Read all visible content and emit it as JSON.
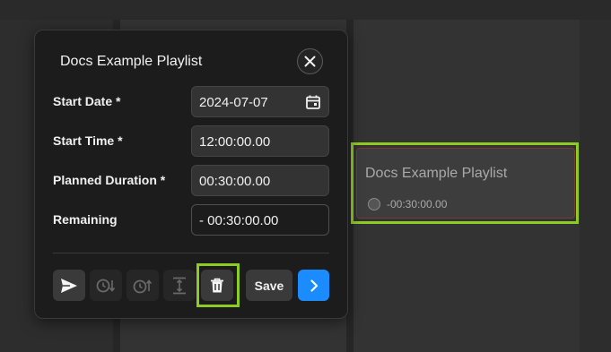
{
  "dialog": {
    "title": "Docs Example Playlist",
    "fields": {
      "start_date": {
        "label": "Start Date *",
        "value": "2024-07-07"
      },
      "start_time": {
        "label": "Start Time *",
        "value": "12:00:00.00"
      },
      "planned_duration": {
        "label": "Planned Duration *",
        "value": "00:30:00.00"
      },
      "remaining": {
        "label": "Remaining",
        "value": "- 00:30:00.00"
      }
    },
    "toolbar": {
      "save_label": "Save"
    }
  },
  "event": {
    "title": "Docs Example Playlist",
    "duration": "-00:30:00.00"
  },
  "colors": {
    "accent_blue": "#1a8cff",
    "highlight_green": "#8fcc23",
    "dialog_bg": "#1c1c1c"
  },
  "icons": [
    "close-icon",
    "calendar-icon",
    "send-icon",
    "timer-down-icon",
    "timer-up-icon",
    "fit-height-icon",
    "trash-icon",
    "chevron-right-icon"
  ]
}
